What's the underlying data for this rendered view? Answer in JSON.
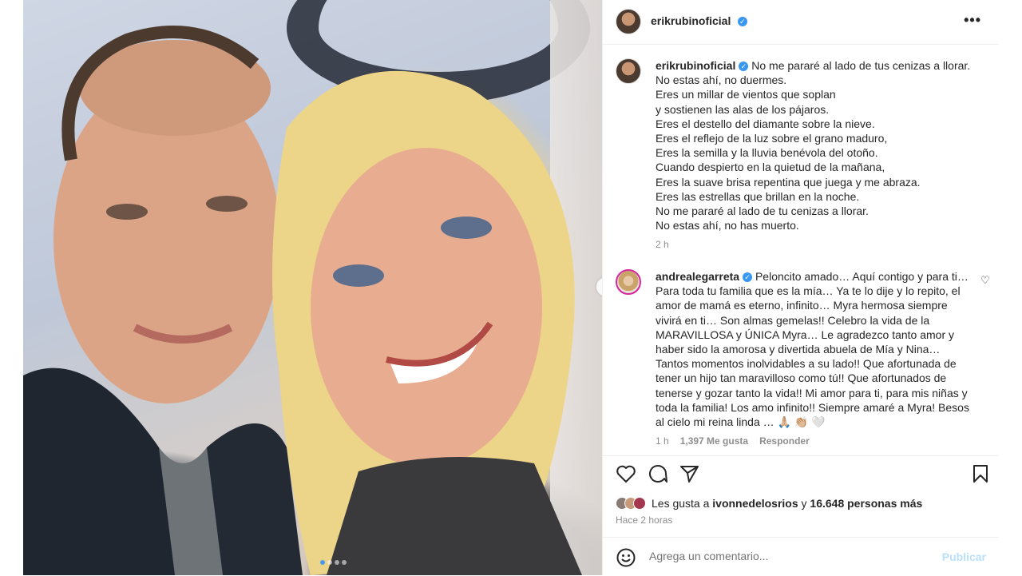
{
  "post": {
    "author": "erikrubinoficial",
    "media_count": 4,
    "active_media_index": 0
  },
  "caption": {
    "author": "erikrubinoficial",
    "lines": [
      "No me pararé al lado de tus cenizas a llorar.",
      "No estas ahí, no duermes.",
      "Eres un millar de vientos que soplan",
      "y sostienen las alas de los pájaros.",
      "Eres el destello del diamante sobre la nieve.",
      "Eres el reflejo de la luz sobre el grano maduro,",
      "Eres la semilla y la lluvia benévola del otoño.",
      "Cuando despierto en la quietud de la mañana,",
      "Eres la suave brisa repentina que juega y me abraza.",
      "Eres las estrellas que brillan en la noche.",
      "No me pararé al lado de tu cenizas a llorar.",
      "No estas ahí, no has muerto."
    ],
    "time": "2 h"
  },
  "comment": {
    "author": "andrealegarreta",
    "lines": [
      "Peloncito amado… Aquí contigo y para ti…",
      "Para toda tu familia que es la mía… Ya te lo dije y lo repito, el",
      "amor de mamá es eterno, infinito… Myra hermosa siempre",
      "vivirá en ti… Son almas gemelas!! Celebro la vida de la",
      "MARAVILLOSA y ÚNICA Myra… Le agradezco tanto amor y",
      "haber sido la amorosa y divertida abuela de Mía y Nina…",
      "Tantos momentos inolvidables a su lado!! Que afortunada de",
      "tener un hijo tan maravilloso como tú!! Que afortunados de",
      "tenerse y gozar tanto la vida!! Mi amor para ti, para mis niñas y",
      "toda la familia! Los amo infinito!! Siempre amaré a Myra! Besos",
      "al cielo mi reina linda … 🙏🏼 👏🏼 🤍"
    ],
    "time": "1 h",
    "likes": "1,397 Me gusta",
    "reply_label": "Responder"
  },
  "likes": {
    "prefix": "Les gusta a",
    "user": "ivonnedelosrios",
    "middle": "y",
    "count": "16.648 personas más"
  },
  "timestamp": "Hace 2 horas",
  "composer": {
    "placeholder": "Agrega un comentario...",
    "publish_label": "Publicar"
  },
  "icons": {
    "like": "heart-icon",
    "comment": "comment-icon",
    "share": "share-icon",
    "save": "bookmark-icon",
    "emoji": "emoji-icon",
    "more": "more-icon"
  },
  "colors": {
    "verified": "#3897f0",
    "publish_disabled": "#b9dffc",
    "carousel_active_dot": "#4a9bf0"
  }
}
